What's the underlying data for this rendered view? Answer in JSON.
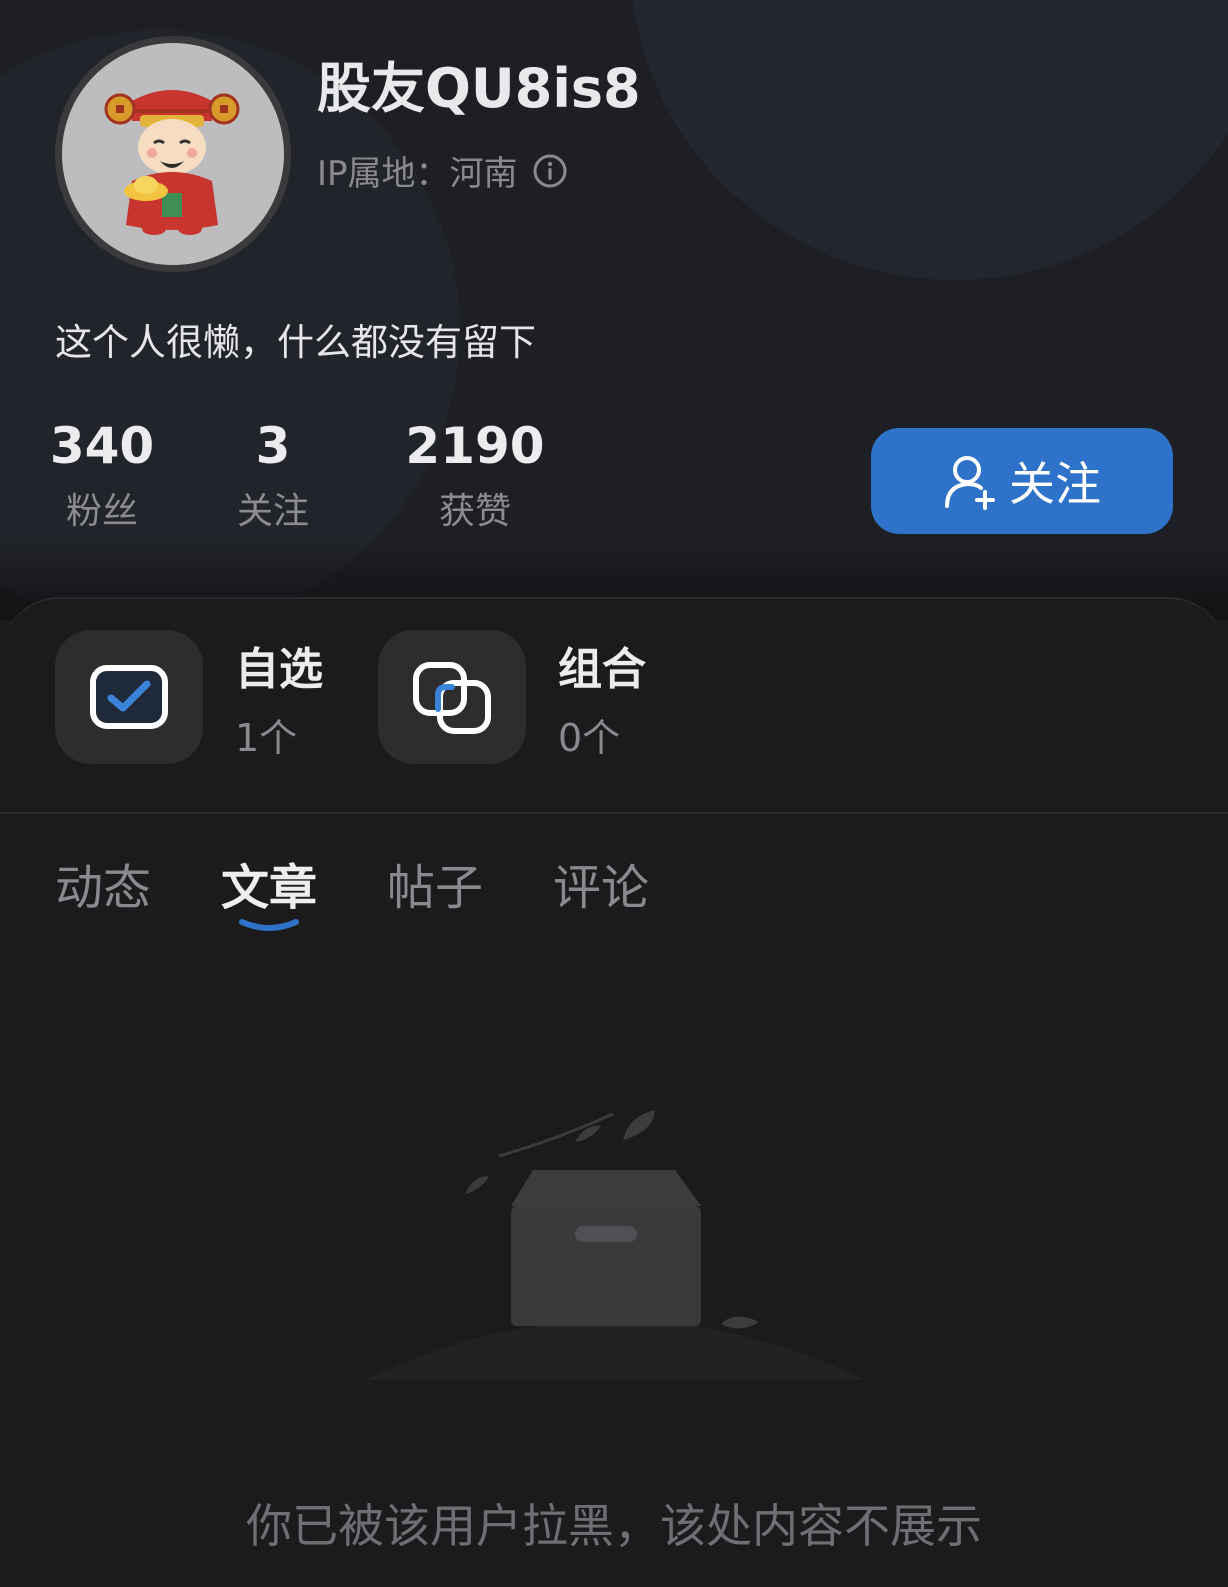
{
  "profile": {
    "username": "股友QU8is8",
    "ip_location": "IP属地：河南",
    "bio": "这个人很懒，什么都没有留下",
    "avatar_icon": "god-of-wealth-avatar"
  },
  "stats": [
    {
      "value": "340",
      "label": "粉丝"
    },
    {
      "value": "3",
      "label": "关注"
    },
    {
      "value": "2190",
      "label": "获赞"
    }
  ],
  "follow_button": {
    "label": "关注",
    "icon": "add-user-icon",
    "color": "#2e73c9"
  },
  "watchlists": [
    {
      "title": "自选",
      "count": "1个",
      "icon": "checkbox-icon"
    },
    {
      "title": "组合",
      "count": "0个",
      "icon": "portfolio-squares-icon"
    }
  ],
  "tabs": [
    {
      "label": "动态",
      "active": false
    },
    {
      "label": "文章",
      "active": true
    },
    {
      "label": "帖子",
      "active": false
    },
    {
      "label": "评论",
      "active": false
    }
  ],
  "accent_color": "#2e73c9",
  "empty_state": {
    "icon": "empty-box-icon",
    "message": "你已被该用户拉黑，该处内容不展示"
  }
}
